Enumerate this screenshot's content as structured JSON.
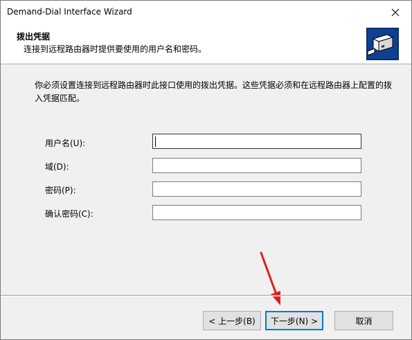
{
  "window": {
    "title": "Demand-Dial Interface Wizard"
  },
  "header": {
    "title": "拨出凭据",
    "subtitle": "连接到远程路由器时提供要使用的用户名和密码。"
  },
  "main": {
    "description": "你必须设置连接到远程路由器时此接口使用的拨出凭据。这些凭据必须和在远程路由器上配置的拨入凭据匹配。",
    "fields": [
      {
        "label": "用户名(U):",
        "value": ""
      },
      {
        "label": "域(D):",
        "value": ""
      },
      {
        "label": "密码(P):",
        "value": ""
      },
      {
        "label": "确认密码(C):",
        "value": ""
      }
    ]
  },
  "buttons": {
    "back": "< 上一步(B)",
    "next": "下一步(N) >",
    "cancel": "取消"
  },
  "colors": {
    "annotation_arrow": "#e02020",
    "default_button_border": "#0078d7"
  }
}
